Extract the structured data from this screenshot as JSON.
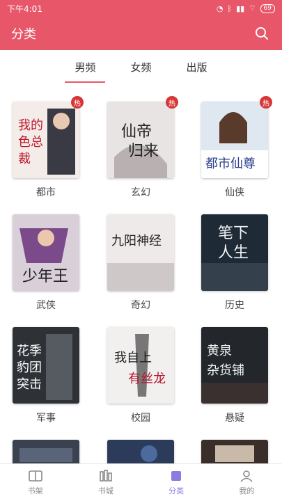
{
  "status": {
    "time": "下午4:01",
    "battery": "69"
  },
  "appbar": {
    "title": "分类"
  },
  "tabs": [
    "男频",
    "女频",
    "出版"
  ],
  "categories": [
    {
      "label": "都市",
      "hot": "热",
      "cover_text": "我的绝色总裁"
    },
    {
      "label": "玄幻",
      "hot": "热",
      "cover_text": "仙帝归来"
    },
    {
      "label": "仙侠",
      "hot": "热",
      "cover_text": "都市仙尊"
    },
    {
      "label": "武侠",
      "hot": "",
      "cover_text": "少年王"
    },
    {
      "label": "奇幻",
      "hot": "",
      "cover_text": "九阳神经"
    },
    {
      "label": "历史",
      "hot": "",
      "cover_text": "笔下人生"
    },
    {
      "label": "军事",
      "hot": "",
      "cover_text": "花季豹团突击队"
    },
    {
      "label": "校园",
      "hot": "",
      "cover_text": "我自上有丝龙"
    },
    {
      "label": "悬疑",
      "hot": "",
      "cover_text": "黄泉杂货铺"
    }
  ],
  "bottom_nav": [
    {
      "label": "书架",
      "icon": "bookshelf-icon"
    },
    {
      "label": "书城",
      "icon": "bookstore-icon"
    },
    {
      "label": "分类",
      "icon": "category-icon"
    },
    {
      "label": "我的",
      "icon": "profile-icon"
    }
  ],
  "colors": {
    "brand": "#e8566a",
    "hot_badge": "#d83636",
    "active_nav": "#8f7ae0"
  }
}
